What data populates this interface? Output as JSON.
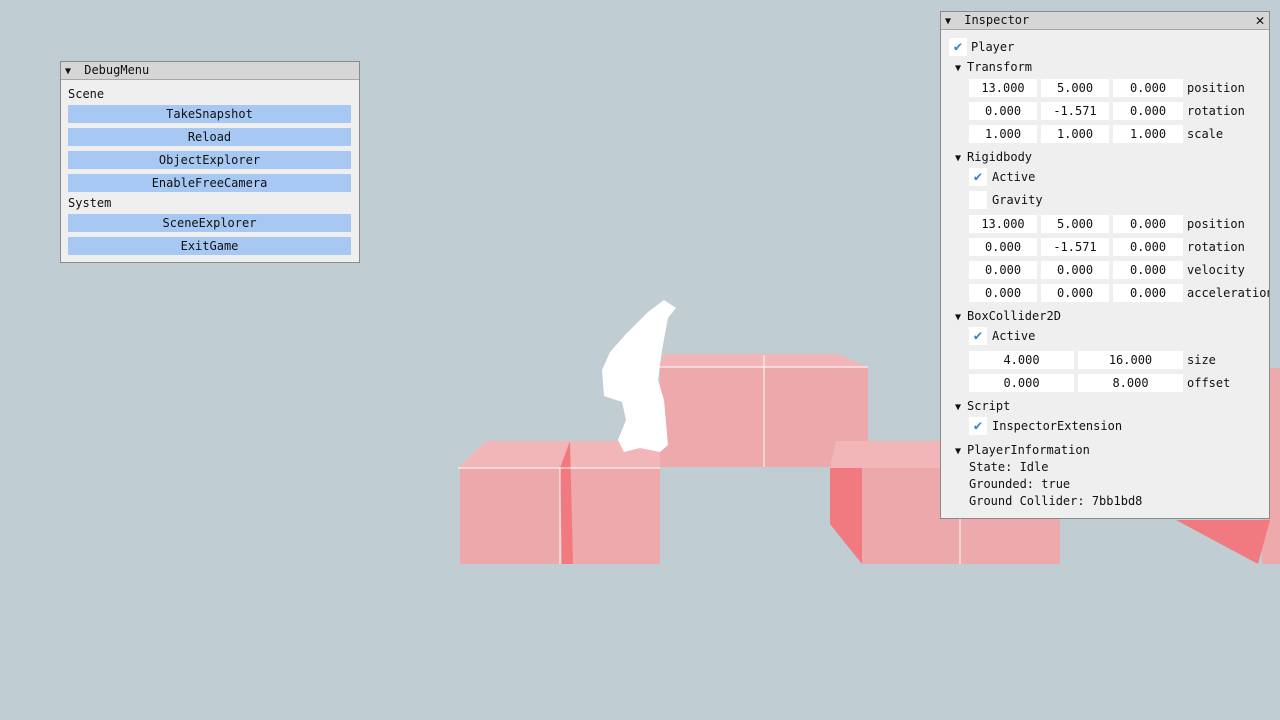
{
  "debug_menu": {
    "title": "DebugMenu",
    "sections": [
      {
        "label": "Scene",
        "buttons": [
          "TakeSnapshot",
          "Reload",
          "ObjectExplorer",
          "EnableFreeCamera"
        ]
      },
      {
        "label": "System",
        "buttons": [
          "SceneExplorer",
          "ExitGame"
        ]
      }
    ]
  },
  "inspector": {
    "title": "Inspector",
    "object": {
      "enabled": true,
      "name": "Player"
    },
    "transform": {
      "header": "Transform",
      "rows": [
        {
          "values": [
            "13.000",
            "5.000",
            "0.000"
          ],
          "label": "position"
        },
        {
          "values": [
            "0.000",
            "-1.571",
            "0.000"
          ],
          "label": "rotation"
        },
        {
          "values": [
            "1.000",
            "1.000",
            "1.000"
          ],
          "label": "scale"
        }
      ]
    },
    "rigidbody": {
      "header": "Rigidbody",
      "active": {
        "checked": true,
        "label": "Active"
      },
      "gravity": {
        "checked": false,
        "label": "Gravity"
      },
      "rows": [
        {
          "values": [
            "13.000",
            "5.000",
            "0.000"
          ],
          "label": "position"
        },
        {
          "values": [
            "0.000",
            "-1.571",
            "0.000"
          ],
          "label": "rotation"
        },
        {
          "values": [
            "0.000",
            "0.000",
            "0.000"
          ],
          "label": "velocity"
        },
        {
          "values": [
            "0.000",
            "0.000",
            "0.000"
          ],
          "label": "acceleration"
        }
      ]
    },
    "boxcollider": {
      "header": "BoxCollider2D",
      "active": {
        "checked": true,
        "label": "Active"
      },
      "rows": [
        {
          "values": [
            "4.000",
            "16.000"
          ],
          "label": "size"
        },
        {
          "values": [
            "0.000",
            "8.000"
          ],
          "label": "offset"
        }
      ]
    },
    "script": {
      "header": "Script",
      "item": {
        "checked": true,
        "label": "InspectorExtension"
      }
    },
    "player_info": {
      "header": "PlayerInformation",
      "lines": [
        "State: Idle",
        "Grounded: true",
        "Ground Collider: 7bb1bd8"
      ]
    }
  },
  "icons": {
    "collapse": "collapse-triangle-icon",
    "close": "close-icon",
    "check": "checkmark-icon"
  },
  "colors": {
    "background": "#c0cdd2",
    "button": "#a7c8f2",
    "check": "#3b7fd0",
    "block": "#eea8aa"
  }
}
